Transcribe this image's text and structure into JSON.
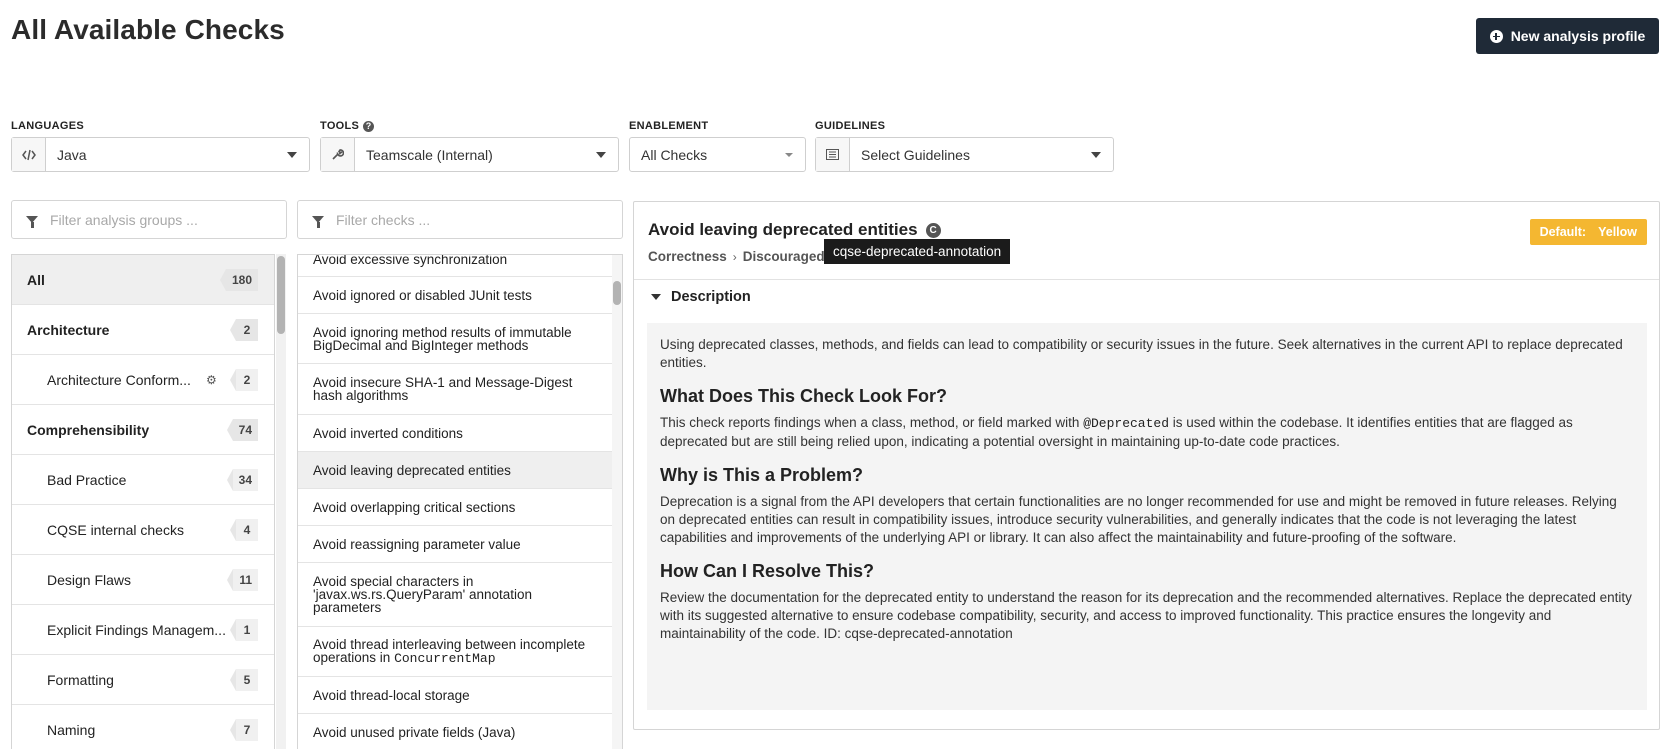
{
  "page": {
    "title": "All Available Checks",
    "new_profile_label": "New analysis profile"
  },
  "filters": {
    "languages": {
      "label": "LANGUAGES",
      "value": "Java",
      "icon": "code-icon"
    },
    "tools": {
      "label": "TOOLS",
      "value": "Teamscale (Internal)",
      "icon": "wrench-icon"
    },
    "enablement": {
      "label": "ENABLEMENT",
      "value": "All Checks"
    },
    "guidelines": {
      "label": "GUIDELINES",
      "value": "Select Guidelines",
      "icon": "list-icon"
    }
  },
  "groups_filter": {
    "placeholder": "Filter analysis groups ..."
  },
  "checks_filter": {
    "placeholder": "Filter checks ..."
  },
  "groups": [
    {
      "label": "All",
      "count": "180",
      "top": true,
      "active": true
    },
    {
      "label": "Architecture",
      "count": "2",
      "top": true
    },
    {
      "label": "Architecture Conform...",
      "count": "2",
      "gear": true
    },
    {
      "label": "Comprehensibility",
      "count": "74",
      "top": true
    },
    {
      "label": "Bad Practice",
      "count": "34"
    },
    {
      "label": "CQSE internal checks",
      "count": "4"
    },
    {
      "label": "Design Flaws",
      "count": "11"
    },
    {
      "label": "Explicit Findings Managem...",
      "count": "1"
    },
    {
      "label": "Formatting",
      "count": "5"
    },
    {
      "label": "Naming",
      "count": "7"
    }
  ],
  "checks": [
    {
      "label": "Avoid excessive synchronization"
    },
    {
      "label": "Avoid ignored or disabled JUnit tests"
    },
    {
      "label": "Avoid ignoring method results of immutable BigDecimal and BigInteger methods"
    },
    {
      "label": "Avoid insecure SHA-1 and Message-Digest hash algorithms"
    },
    {
      "label": "Avoid inverted conditions"
    },
    {
      "label": "Avoid leaving deprecated entities",
      "active": true
    },
    {
      "label": "Avoid overlapping critical sections"
    },
    {
      "label": "Avoid reassigning parameter value"
    },
    {
      "label": "Avoid special characters in 'javax.ws.rs.QueryParam' annotation parameters"
    },
    {
      "label": "Avoid thread interleaving between incomplete operations in",
      "mono_suffix": "ConcurrentMap"
    },
    {
      "label": "Avoid thread-local storage"
    },
    {
      "label": "Avoid unused private fields (Java)"
    }
  ],
  "details": {
    "title": "Avoid leaving deprecated entities",
    "crumb_category": "Correctness",
    "crumb_group": "Discouraged",
    "tooltip": "cqse-deprecated-annotation",
    "default_label": "Default:",
    "default_value": "Yellow",
    "default_color": "#f4b731",
    "description_header": "Description",
    "intro": "Using deprecated classes, methods, and fields can lead to compatibility or security issues in the future. Seek alternatives in the current API to replace deprecated entities.",
    "h1": "What Does This Check Look For?",
    "p1_before": "This check reports findings when a class, method, or field marked with ",
    "p1_code": "@Deprecated",
    "p1_after": " is used within the codebase. It identifies entities that are flagged as deprecated but are still being relied upon, indicating a potential oversight in maintaining up-to-date code practices.",
    "h2": "Why is This a Problem?",
    "p2": "Deprecation is a signal from the API developers that certain functionalities are no longer recommended for use and might be removed in future releases. Relying on deprecated entities can result in compatibility issues, introduce security vulnerabilities, and generally indicates that the code is not leveraging the latest capabilities and improvements of the underlying API or library. It can also affect the maintainability and future-proofing of the software.",
    "h3": "How Can I Resolve This?",
    "p3": "Review the documentation for the deprecated entity to understand the reason for its deprecation and the recommended alternatives. Replace the deprecated entity with its suggested alternative to ensure codebase compatibility, security, and access to improved functionality. This practice ensures the longevity and maintainability of the code. ID: cqse-deprecated-annotation"
  }
}
